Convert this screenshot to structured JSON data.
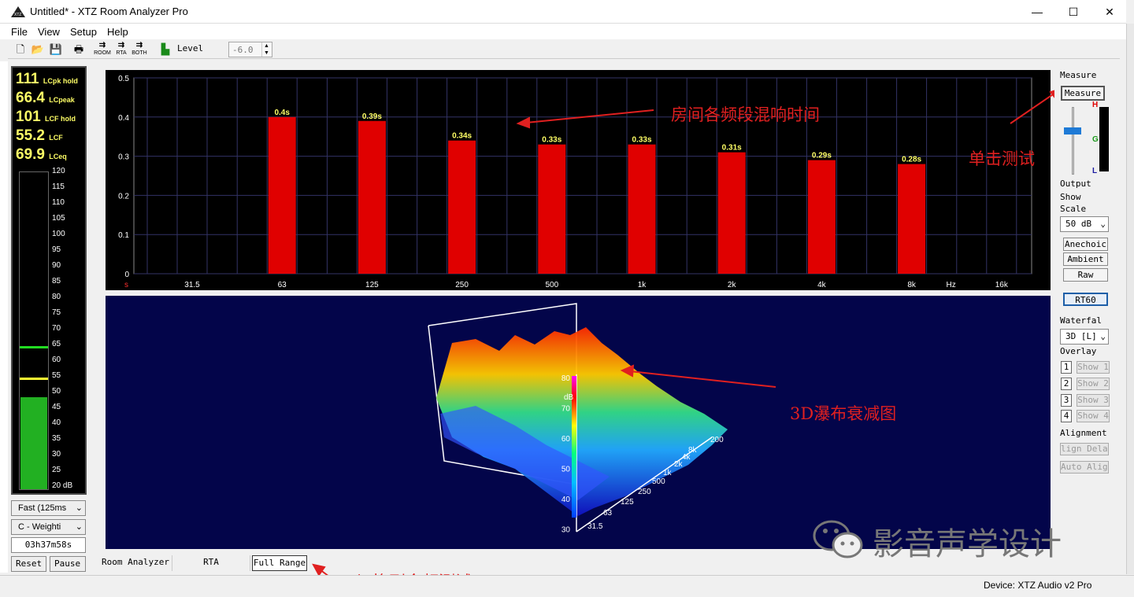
{
  "window": {
    "title": "Untitled* - XTZ Room Analyzer Pro",
    "minimize": "—",
    "maximize": "☐",
    "close": "✕"
  },
  "menu": [
    "File",
    "View",
    "Setup",
    "Help"
  ],
  "toolbar": {
    "room": "ROOM",
    "rta": "RTA",
    "both": "BOTH",
    "level_label": "Level",
    "level_value": "-6.0"
  },
  "meter": {
    "readouts": [
      {
        "value": "111",
        "label": "LCpk hold"
      },
      {
        "value": "66.4",
        "label": "LCpeak"
      },
      {
        "value": "101",
        "label": "LCF hold"
      },
      {
        "value": "55.2",
        "label": "LCF"
      },
      {
        "value": "69.9",
        "label": "LCeq"
      }
    ],
    "scale": [
      "120",
      "115",
      "110",
      "105",
      "100",
      "95",
      "90",
      "85",
      "80",
      "75",
      "70",
      "65",
      "60",
      "55",
      "50",
      "45",
      "40",
      "35",
      "30",
      "25",
      "20 dB"
    ],
    "level_fraction": 0.29,
    "green_marker": 65,
    "yellow_marker": 55,
    "speed": "Fast (125ms",
    "weighting": "C - Weighti",
    "elapsed": "03h37m58s",
    "reset": "Reset",
    "pause": "Pause"
  },
  "chart_data": [
    {
      "type": "bar",
      "categories": [
        "63",
        "125",
        "250",
        "500",
        "1k",
        "2k",
        "4k",
        "8k"
      ],
      "values": [
        0.4,
        0.39,
        0.34,
        0.33,
        0.33,
        0.31,
        0.29,
        0.28
      ],
      "data_labels": [
        "0.4s",
        "0.39s",
        "0.34s",
        "0.33s",
        "0.33s",
        "0.31s",
        "0.29s",
        "0.28s"
      ],
      "x_ticks": [
        "31.5",
        "63",
        "125",
        "250",
        "500",
        "1k",
        "2k",
        "4k",
        "8k",
        "16k"
      ],
      "x_unit": "Hz",
      "y_unit": "s",
      "y_ticks": [
        "0",
        "0.1",
        "0.2",
        "0.3",
        "0.4",
        "0.5"
      ],
      "ylim": [
        0,
        0.5
      ],
      "grid": true,
      "bar_color": "#e00000"
    }
  ],
  "waterfall": {
    "db_label": "dB",
    "db_ticks": [
      "80",
      "70",
      "60",
      "50",
      "40",
      "30"
    ],
    "freq_ticks": [
      "31.5",
      "63",
      "125",
      "250",
      "500",
      "1k",
      "2k",
      "4k",
      "8k",
      "200"
    ]
  },
  "annotations": {
    "rt60": "房间各频段混响时间",
    "click": "单击测试",
    "waterfall": "3D瀑布衰减图",
    "fullrange": "切换到全频测试"
  },
  "right_panel": {
    "measure_group": "Measure",
    "measure_button": "Measure",
    "h": "H",
    "g": "G",
    "l": "L",
    "output": "Output",
    "show": "Show",
    "scale": "Scale",
    "scale_value": "50 dB",
    "anechoic": "Anechoic",
    "ambient": "Ambient",
    "raw": "Raw",
    "rt60": "RT60",
    "waterfall": "Waterfal",
    "waterfall_value": "3D [L]",
    "overlay": "Overlay",
    "overlays": [
      {
        "n": "1",
        "label": "Show 1"
      },
      {
        "n": "2",
        "label": "Show 2"
      },
      {
        "n": "3",
        "label": "Show 3"
      },
      {
        "n": "4",
        "label": "Show 4"
      }
    ],
    "alignment": "Alignment",
    "align_delay": "lign Delay",
    "auto_align": "Auto Align"
  },
  "tabs": [
    "Room Analyzer",
    "RTA",
    "Full Range"
  ],
  "status": {
    "device": "Device: XTZ Audio v2 Pro"
  },
  "watermark": "影音声学设计",
  "colors": {
    "bar": "#e00000",
    "panel_bg": "#000000",
    "waterfall_bg": "#03054a",
    "annotation": "#e02020"
  }
}
